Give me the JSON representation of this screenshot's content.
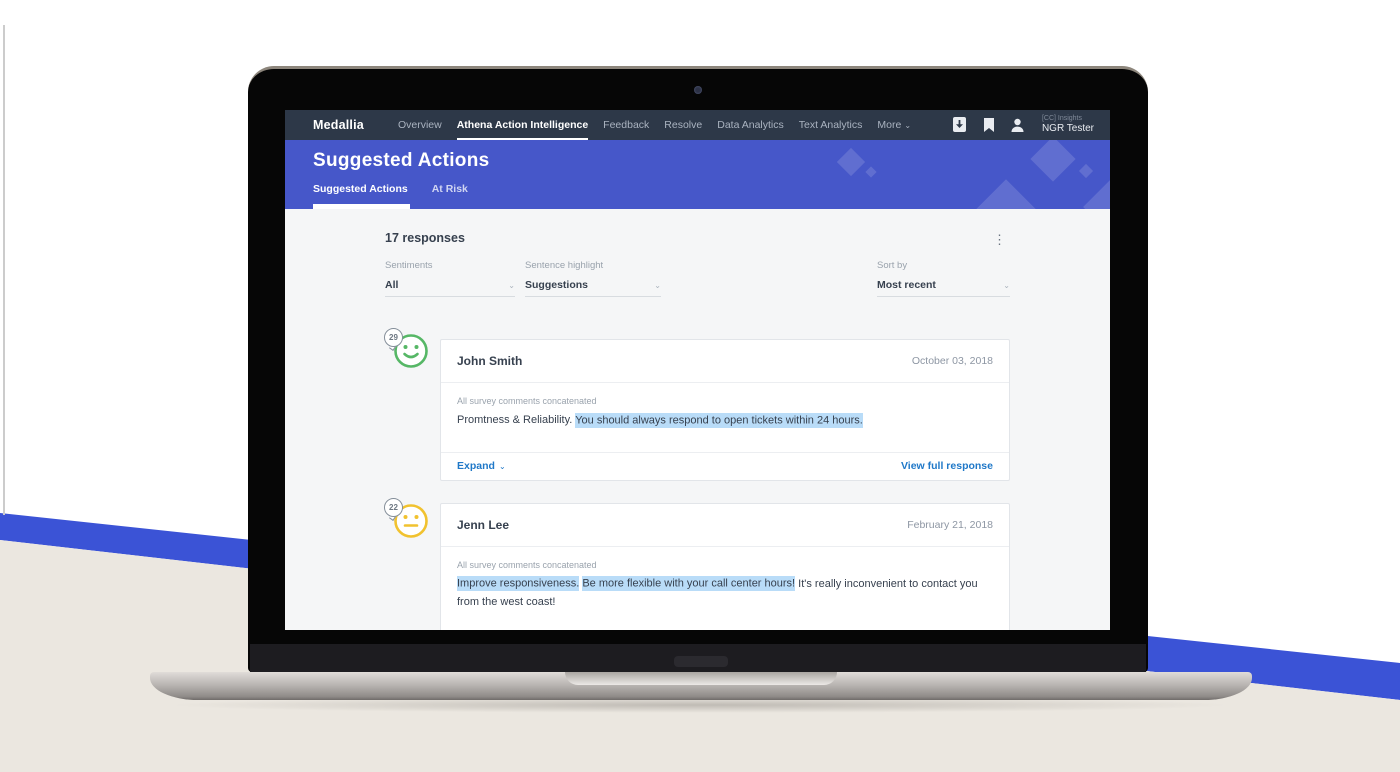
{
  "nav": {
    "brand": "Medallia",
    "items": [
      {
        "label": "Overview",
        "active": false
      },
      {
        "label": "Athena Action Intelligence",
        "active": true
      },
      {
        "label": "Feedback",
        "active": false
      },
      {
        "label": "Resolve",
        "active": false
      },
      {
        "label": "Data Analytics",
        "active": false
      },
      {
        "label": "Text Analytics",
        "active": false
      },
      {
        "label": "More",
        "active": false
      }
    ],
    "account": {
      "org": "[CC] Insights",
      "user": "NGR Tester"
    }
  },
  "header": {
    "title": "Suggested Actions",
    "tabs": [
      {
        "label": "Suggested Actions",
        "active": true
      },
      {
        "label": "At Risk",
        "active": false
      }
    ]
  },
  "toolbar": {
    "responses_count": "17 responses"
  },
  "filters": {
    "sentiments": {
      "label": "Sentiments",
      "value": "All"
    },
    "sentence_highlight": {
      "label": "Sentence highlight",
      "value": "Suggestions"
    },
    "sort_by": {
      "label": "Sort by",
      "value": "Most recent"
    }
  },
  "cards": [
    {
      "score": "29",
      "sentiment": "positive",
      "name": "John Smith",
      "date": "October 03, 2018",
      "comment_label": "All survey comments concatenated",
      "segments": [
        {
          "text": "Promtness & Reliability. ",
          "highlight": false
        },
        {
          "text": "You should always respond to open tickets within 24 hours.",
          "highlight": true
        }
      ],
      "expand_label": "Expand",
      "view_label": "View full response"
    },
    {
      "score": "22",
      "sentiment": "neutral",
      "name": "Jenn Lee",
      "date": "February 21, 2018",
      "comment_label": "All survey comments concatenated",
      "segments": [
        {
          "text": "Improve responsiveness.",
          "highlight": true
        },
        {
          "text": " ",
          "highlight": false
        },
        {
          "text": "Be more flexible with your call center hours!",
          "highlight": true
        },
        {
          "text": " It's really inconvenient to contact you from the west coast!",
          "highlight": false
        }
      ]
    }
  ],
  "icons": {
    "kebab": "⋮",
    "chevron_down": "⌄"
  },
  "colors": {
    "navbar_bg": "#2d3848",
    "header_bg": "#4657c9",
    "stripe_blue": "#3b53d6",
    "beige": "#ebe7e0",
    "highlight": "#b9dcf8",
    "link_blue": "#1f78c8",
    "positive_green": "#56b766",
    "neutral_yellow": "#f1c22f"
  }
}
